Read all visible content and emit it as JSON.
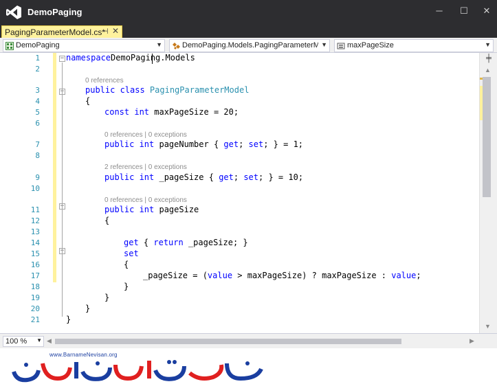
{
  "app": {
    "title": "DemoPaging"
  },
  "window_controls": {
    "minimize": "─",
    "maximize": "☐",
    "close": "✕"
  },
  "tab": {
    "label": "PagingParameterModel.cs*",
    "pin": "⊣",
    "close": "✕"
  },
  "navbar": {
    "project": "DemoPaging",
    "type": "DemoPaging.Models.PagingParameterMoc",
    "member": "maxPageSize"
  },
  "lines": [
    {
      "n": "1",
      "tokens": [
        [
          "kw",
          "namespace"
        ],
        [
          "",
          "DemoPaging.Models"
        ]
      ]
    },
    {
      "n": "",
      "tokens": [
        [
          "",
          "{"
        ]
      ]
    },
    {
      "lens": "0 references"
    },
    {
      "n": "3",
      "tokens": [
        [
          "kw",
          "public class "
        ],
        [
          "ty",
          "PagingParameterModel"
        ]
      ]
    },
    {
      "n": "4",
      "tokens": [
        [
          "",
          "{"
        ]
      ]
    },
    {
      "n": "5",
      "tokens": [
        [
          "kw",
          "const int "
        ],
        [
          "",
          "maxPageSize = 20;"
        ]
      ]
    },
    {
      "n": "6",
      "tokens": []
    },
    {
      "lens": "0 references | 0 exceptions"
    },
    {
      "n": "7",
      "tokens": [
        [
          "kw",
          "public int "
        ],
        [
          "",
          "pageNumber { "
        ],
        [
          "kw",
          "get"
        ],
        [
          "",
          "; "
        ],
        [
          "kw",
          "set"
        ],
        [
          "",
          "; } = 1;"
        ]
      ]
    },
    {
      "n": "8",
      "tokens": []
    },
    {
      "lens": "2 references | 0 exceptions"
    },
    {
      "n": "9",
      "tokens": [
        [
          "kw",
          "public int "
        ],
        [
          "",
          "_pageSize { "
        ],
        [
          "kw",
          "get"
        ],
        [
          "",
          "; "
        ],
        [
          "kw",
          "set"
        ],
        [
          "",
          "; } = 10;"
        ]
      ]
    },
    {
      "n": "10",
      "tokens": []
    },
    {
      "lens": "0 references | 0 exceptions"
    },
    {
      "n": "11",
      "tokens": [
        [
          "kw",
          "public int "
        ],
        [
          "",
          "pageSize"
        ]
      ]
    },
    {
      "n": "12",
      "tokens": [
        [
          "",
          "{"
        ]
      ]
    },
    {
      "n": "13",
      "tokens": []
    },
    {
      "n": "14",
      "tokens": [
        [
          "kw",
          "get"
        ],
        [
          "",
          " { "
        ],
        [
          "kw",
          "return"
        ],
        [
          "",
          " _pageSize; }"
        ]
      ]
    },
    {
      "n": "15",
      "tokens": [
        [
          "kw",
          "set"
        ]
      ]
    },
    {
      "n": "16",
      "tokens": [
        [
          "",
          "{"
        ]
      ]
    },
    {
      "n": "17",
      "tokens": [
        [
          "",
          "_pageSize = ("
        ],
        [
          "kw",
          "value"
        ],
        [
          "",
          " > maxPageSize) ? maxPageSize : "
        ],
        [
          "kw",
          "value"
        ],
        [
          "",
          ";"
        ]
      ]
    },
    {
      "n": "18",
      "tokens": [
        [
          "",
          "}"
        ]
      ]
    },
    {
      "n": "19",
      "tokens": [
        [
          "",
          "}"
        ]
      ]
    },
    {
      "n": "20",
      "tokens": [
        [
          "",
          "}"
        ]
      ]
    },
    {
      "n": "21",
      "tokens": [
        [
          "",
          "}"
        ]
      ]
    }
  ],
  "line2_number": "2",
  "zoom": "100 %",
  "watermark": {
    "url": "www.BarnameNevisan.org"
  },
  "colors": {
    "keyword": "#0000ff",
    "type": "#2b91af",
    "line_number": "#2b91af",
    "modified": "#fff29d",
    "titlebar": "#2d2d30"
  }
}
